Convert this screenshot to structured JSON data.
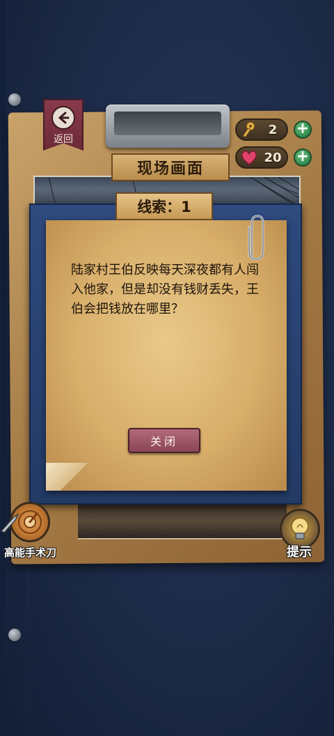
{
  "header": {
    "back_label": "返回",
    "keys_count": "2",
    "hearts_count": "20",
    "plus_symbol": "+"
  },
  "scene": {
    "title": "现场画面"
  },
  "modal": {
    "clue_title": "线索：1",
    "clue_text": "陆家村王伯反映每天深夜都有人闯入他家，但是却没有钱财丢失，王伯会把钱放在哪里？",
    "close_label": "关闭"
  },
  "tools": {
    "scalpel_label": "高能手术刀",
    "hint_label": "提示"
  },
  "icons": {
    "back": "arrow-left-icon",
    "key": "key-icon",
    "heart": "heart-icon",
    "paperclip": "paperclip-icon",
    "scalpel": "scalpel-icon",
    "hint": "lightbulb-icon"
  },
  "colors": {
    "background": "#1d2a44",
    "modal": "#27406e",
    "close_button": "#8a4656",
    "plus_button": "#2f8a4c",
    "heart": "#e2436a"
  }
}
